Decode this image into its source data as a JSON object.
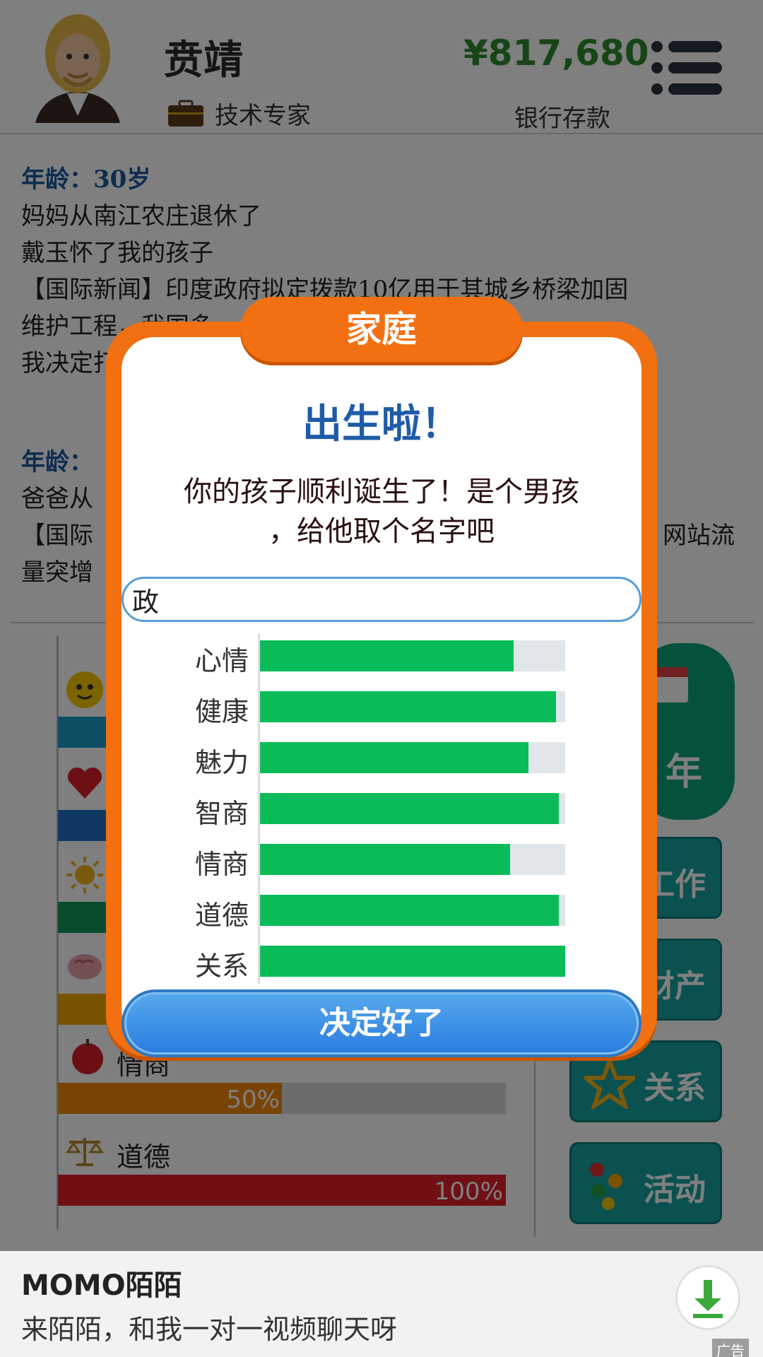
{
  "header": {
    "name": "贲靖",
    "job": "技术专家",
    "money": "¥817,680",
    "bank_label": "银行存款"
  },
  "log": {
    "entry1": {
      "age": "年龄：30岁",
      "lines": [
        "妈妈从南江农庄退休了",
        "戴玉怀了我的孩子",
        "【国际新闻】印度政府拟定拨款10亿用于其城乡桥梁加固",
        "维护工程，我国多",
        "我决定打"
      ]
    },
    "entry2": {
      "age": "年龄：",
      "lines": [
        "爸爸从",
        "【国际",
        "量突增"
      ],
      "tail": "网站流"
    }
  },
  "stats_bg": {
    "eq_pct": "50%",
    "eq_value": 0.5,
    "eq_label": "情商",
    "morality_label": "道德",
    "morality_pct": "100%",
    "morality_value": 1.0
  },
  "side_buttons": {
    "next_year": "年",
    "work": "工作",
    "assets": "财产",
    "relations": "关系",
    "activities": "活动"
  },
  "modal": {
    "tab_title": "家庭",
    "heading": "出生啦！",
    "message_line1": "你的孩子顺利诞生了！是个男孩",
    "message_line2": "，给他取个名字吧",
    "name_value": "政",
    "confirm_label": "决定好了",
    "stats": [
      {
        "label": "心情",
        "value": 0.83
      },
      {
        "label": "健康",
        "value": 0.97
      },
      {
        "label": "魅力",
        "value": 0.88
      },
      {
        "label": "智商",
        "value": 0.98
      },
      {
        "label": "情商",
        "value": 0.82
      },
      {
        "label": "道德",
        "value": 0.98
      },
      {
        "label": "关系",
        "value": 1.0
      }
    ]
  },
  "ad": {
    "title": "MOMO陌陌",
    "text": "来陌陌，和我一对一视频聊天呀",
    "tag": "广告"
  },
  "colors": {
    "modal_orange": "#f37012",
    "stat_green": "#09bc59",
    "money_green": "#2e8b2e",
    "heading_blue": "#1f5ca8",
    "teal_button": "#14a3a0"
  }
}
